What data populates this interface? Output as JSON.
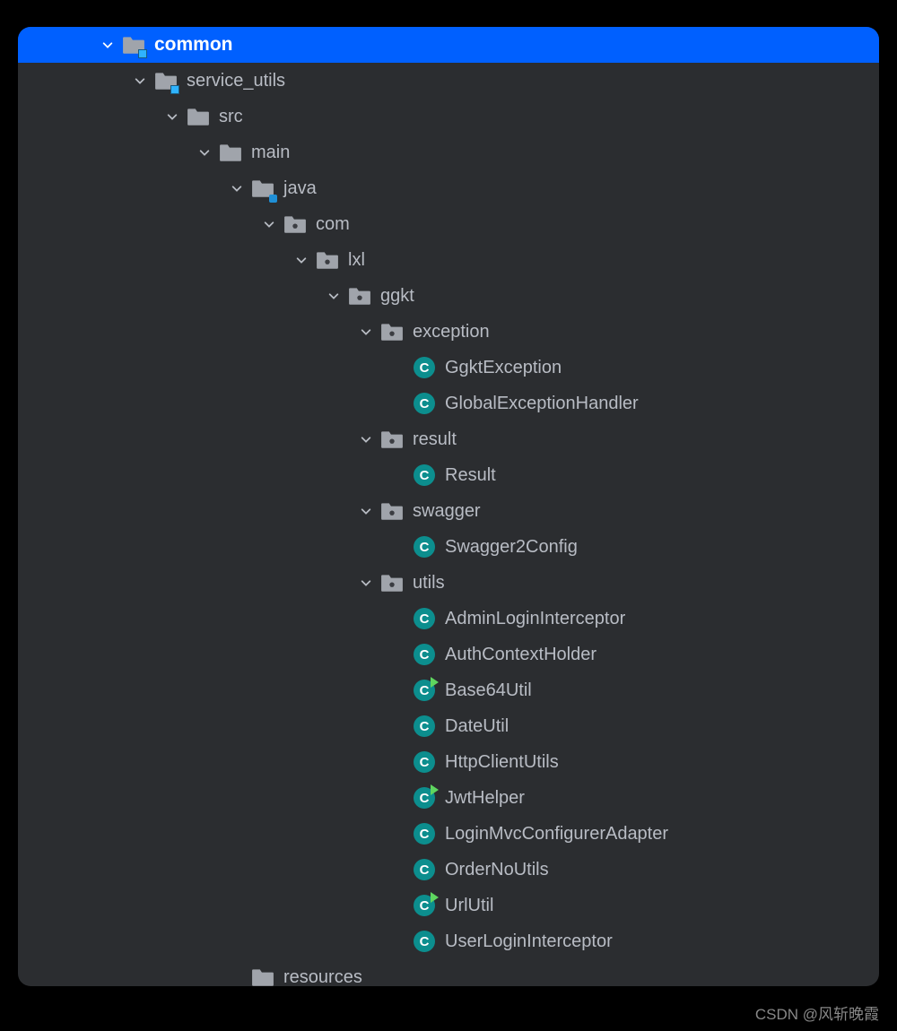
{
  "tree": [
    {
      "depth": 0,
      "chevron": "down",
      "icon": "module",
      "label": "common",
      "selected": true
    },
    {
      "depth": 1,
      "chevron": "down",
      "icon": "module",
      "label": "service_utils"
    },
    {
      "depth": 2,
      "chevron": "down",
      "icon": "folder",
      "label": "src"
    },
    {
      "depth": 3,
      "chevron": "down",
      "icon": "folder",
      "label": "main"
    },
    {
      "depth": 4,
      "chevron": "down",
      "icon": "source-folder",
      "label": "java"
    },
    {
      "depth": 5,
      "chevron": "down",
      "icon": "package",
      "label": "com"
    },
    {
      "depth": 6,
      "chevron": "down",
      "icon": "package",
      "label": "lxl"
    },
    {
      "depth": 7,
      "chevron": "down",
      "icon": "package",
      "label": "ggkt"
    },
    {
      "depth": 8,
      "chevron": "down",
      "icon": "package",
      "label": "exception"
    },
    {
      "depth": 9,
      "chevron": "none",
      "icon": "class",
      "label": "GgktException"
    },
    {
      "depth": 9,
      "chevron": "none",
      "icon": "class",
      "label": "GlobalExceptionHandler"
    },
    {
      "depth": 8,
      "chevron": "down",
      "icon": "package",
      "label": "result"
    },
    {
      "depth": 9,
      "chevron": "none",
      "icon": "class",
      "label": "Result"
    },
    {
      "depth": 8,
      "chevron": "down",
      "icon": "package",
      "label": "swagger"
    },
    {
      "depth": 9,
      "chevron": "none",
      "icon": "class",
      "label": "Swagger2Config"
    },
    {
      "depth": 8,
      "chevron": "down",
      "icon": "package",
      "label": "utils"
    },
    {
      "depth": 9,
      "chevron": "none",
      "icon": "class",
      "label": "AdminLoginInterceptor"
    },
    {
      "depth": 9,
      "chevron": "none",
      "icon": "class",
      "label": "AuthContextHolder"
    },
    {
      "depth": 9,
      "chevron": "none",
      "icon": "class-run",
      "label": "Base64Util"
    },
    {
      "depth": 9,
      "chevron": "none",
      "icon": "class",
      "label": "DateUtil"
    },
    {
      "depth": 9,
      "chevron": "none",
      "icon": "class",
      "label": "HttpClientUtils"
    },
    {
      "depth": 9,
      "chevron": "none",
      "icon": "class-run",
      "label": "JwtHelper"
    },
    {
      "depth": 9,
      "chevron": "none",
      "icon": "class",
      "label": "LoginMvcConfigurerAdapter"
    },
    {
      "depth": 9,
      "chevron": "none",
      "icon": "class",
      "label": "OrderNoUtils"
    },
    {
      "depth": 9,
      "chevron": "none",
      "icon": "class-run",
      "label": "UrlUtil"
    },
    {
      "depth": 9,
      "chevron": "none",
      "icon": "class",
      "label": "UserLoginInterceptor"
    },
    {
      "depth": 4,
      "chevron": "none",
      "icon": "resource-folder",
      "label": "resources"
    }
  ],
  "indent": {
    "base": 90,
    "step": 36
  },
  "watermark": "CSDN @风斩晚霞"
}
